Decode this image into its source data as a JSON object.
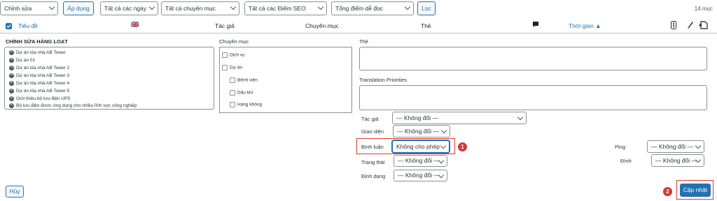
{
  "toolbar": {
    "bulk_action": "Chỉnh sửa",
    "apply_label": "Áp dụng",
    "date_filter": "Tất cả các ngày",
    "category_filter": "Tất cả chuyên mục",
    "seo_filter": "Tất cả các Điểm SEO",
    "readability_filter": "Tổng điểm dễ đọc",
    "filter_label": "Lọc",
    "items_count": "14 mục"
  },
  "table_header": {
    "title": "Tiêu đề",
    "flag": "🇬🇧",
    "author": "Tác giả",
    "categories": "Chuyên mục",
    "tags": "Thẻ",
    "date": "Thời gian ▲"
  },
  "bulk_edit": {
    "heading": "CHỈNH SỬA HÀNG LOẠT",
    "posts": [
      "Dự án tòa nhà AB Tower",
      "Dự án 01",
      "Dự án tòa nhà AB Tower 2",
      "Dự án tòa nhà AB Tower 3",
      "Dự án tòa nhà AB Tower 4",
      "Dự án tòa nhà AB Tower 5",
      "Giới thiệu bộ lưu điện UPS",
      "Bộ lưu điện được ứng dụng cho nhiều lĩnh vực công nghiệp"
    ],
    "categories_label": "Chuyên mục",
    "categories": [
      "Dịch vụ",
      "Dự án",
      "Bệnh viện",
      "Dầu khí",
      "Hàng không"
    ],
    "tags_label": "Thẻ",
    "translation_label": "Translation Priorities",
    "author_label": "Tác giả",
    "author_value": "— Không đổi —",
    "theme_label": "Giao diện",
    "theme_value": "— Không đổi —",
    "comments_label": "Bình luận",
    "comments_value": "Không cho phép",
    "status_label": "Trạng thái",
    "status_value": "— Không đổi —",
    "format_label": "Định dạng",
    "format_value": "— Không đổi —",
    "ping_label": "Ping",
    "ping_value": "— Không đổi —",
    "sticky_label": "Đính",
    "sticky_value": "— Không đổi —",
    "cancel_label": "Hủy",
    "update_label": "Cập nhật",
    "badge_1": "1",
    "badge_2": "2"
  },
  "colors": {
    "accent": "#2271b1",
    "annotation_red": "#d63638"
  }
}
